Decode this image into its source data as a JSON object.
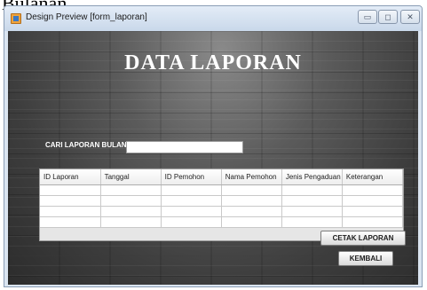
{
  "page_caption": "Bulanan",
  "window": {
    "title": "Design Preview [form_laporan]",
    "controls": {
      "minimize_icon": "minimize-icon",
      "maximize_icon": "maximize-icon",
      "close_icon": "close-icon"
    }
  },
  "form": {
    "heading": "DATA LAPORAN",
    "search_label": "CARI LAPORAN BULAN :",
    "search_value": "",
    "table": {
      "columns": [
        "ID Laporan",
        "Tanggal",
        "ID Pemohon",
        "Nama Pemohon",
        "Jenis Pengaduan",
        "Keterangan"
      ],
      "empty_rows": 4
    },
    "buttons": {
      "print": "CETAK LAPORAN",
      "back": "KEMBALI"
    }
  },
  "colors": {
    "heading_text": "#ffffff",
    "titlebar": "#c9d8ea",
    "background": "#4a4a4a"
  }
}
